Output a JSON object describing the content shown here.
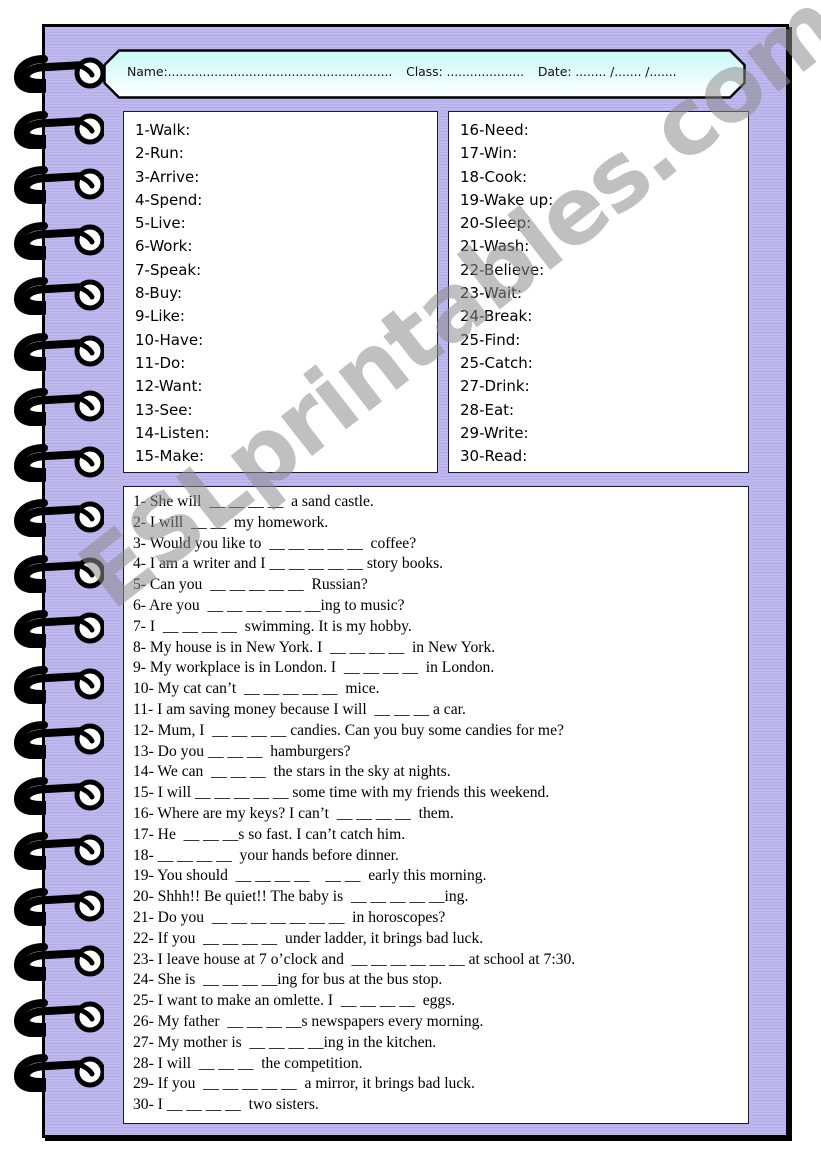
{
  "header": {
    "name_label": "Name:..........................................................",
    "class_label": "Class: ....................",
    "date_label": "Date: ........ /....... /......."
  },
  "verbs_left": [
    "1-Walk:",
    "2-Run:",
    "3-Arrive:",
    "4-Spend:",
    "5-Live:",
    "6-Work:",
    "7-Speak:",
    "8-Buy:",
    "9-Like:",
    "10-Have:",
    "11-Do:",
    "12-Want:",
    "13-See:",
    "14-Listen:",
    "15-Make:"
  ],
  "verbs_right": [
    "16-Need:",
    "17-Win:",
    "18-Cook:",
    "19-Wake up:",
    "20-Sleep:",
    "21-Wash:",
    "22-Believe:",
    "23-Wait:",
    "24-Break:",
    "25-Find:",
    "25-Catch:",
    "27-Drink:",
    "28-Eat:",
    "29-Write:",
    "30-Read:"
  ],
  "sentences": [
    "1- She will  __ __ __ __  a sand castle.",
    "2- I will  __ __  my homework.",
    "3- Would you like to  __ __ __ __ __  coffee?",
    "4- I am a writer and I __ __ __ __ __ story books.",
    "5- Can you  __ __ __ __ __  Russian?",
    "6- Are you  __ __ __ __ __ __ing to music?",
    "7- I  __ __ __ __  swimming. It is my hobby.",
    "8- My house is in New York. I  __ __ __ __  in New York.",
    "9- My workplace is in London. I  __ __ __ __  in London.",
    "10- My cat can’t  __ __ __ __ __  mice.",
    "11- I am saving money because I will  __ __ __ a car.",
    "12- Mum, I  __ __ __ __ candies. Can you buy some candies for me?",
    "13- Do you __ __ __  hamburgers?",
    "14- We can  __ __ __  the stars in the sky at nights.",
    "15- I will __ __ __ __ __ some time with my friends this weekend.",
    "16- Where are my keys? I can’t  __ __ __ __  them.",
    "17- He  __ __ __s so fast. I can’t catch him.",
    "18- __ __ __ __  your hands before dinner.",
    "19- You should  __ __ __ __    __ __  early this morning.",
    "20- Shhh!! Be quiet!! The baby is  __ __ __ __ __ing.",
    "21- Do you  __ __ __ __ __ __ __  in horoscopes?",
    "22- If you  __ __ __ __  under ladder, it brings bad luck.",
    "23- I leave house at 7 o’clock and  __ __ __ __ __ __ at school at 7:30.",
    "24- She is  __ __ __ __ing for bus at the bus stop.",
    "25- I want to make an omlette. I  __ __ __ __  eggs.",
    "26- My father  __ __ __ __s newspapers every morning.",
    "27- My mother is  __ __ __ __ing in the kitchen.",
    "28- I will  __ __ __  the competition.",
    "29- If you  __ __ __ __ __  a mirror, it brings bad luck.",
    "30- I __ __ __ __  two sisters."
  ],
  "watermark": "ESLprintables.com",
  "colors": {
    "page_background": "#b9b5ec",
    "header_gradient_top": "#c8f8f8",
    "header_gradient_bottom": "#ffffff"
  }
}
